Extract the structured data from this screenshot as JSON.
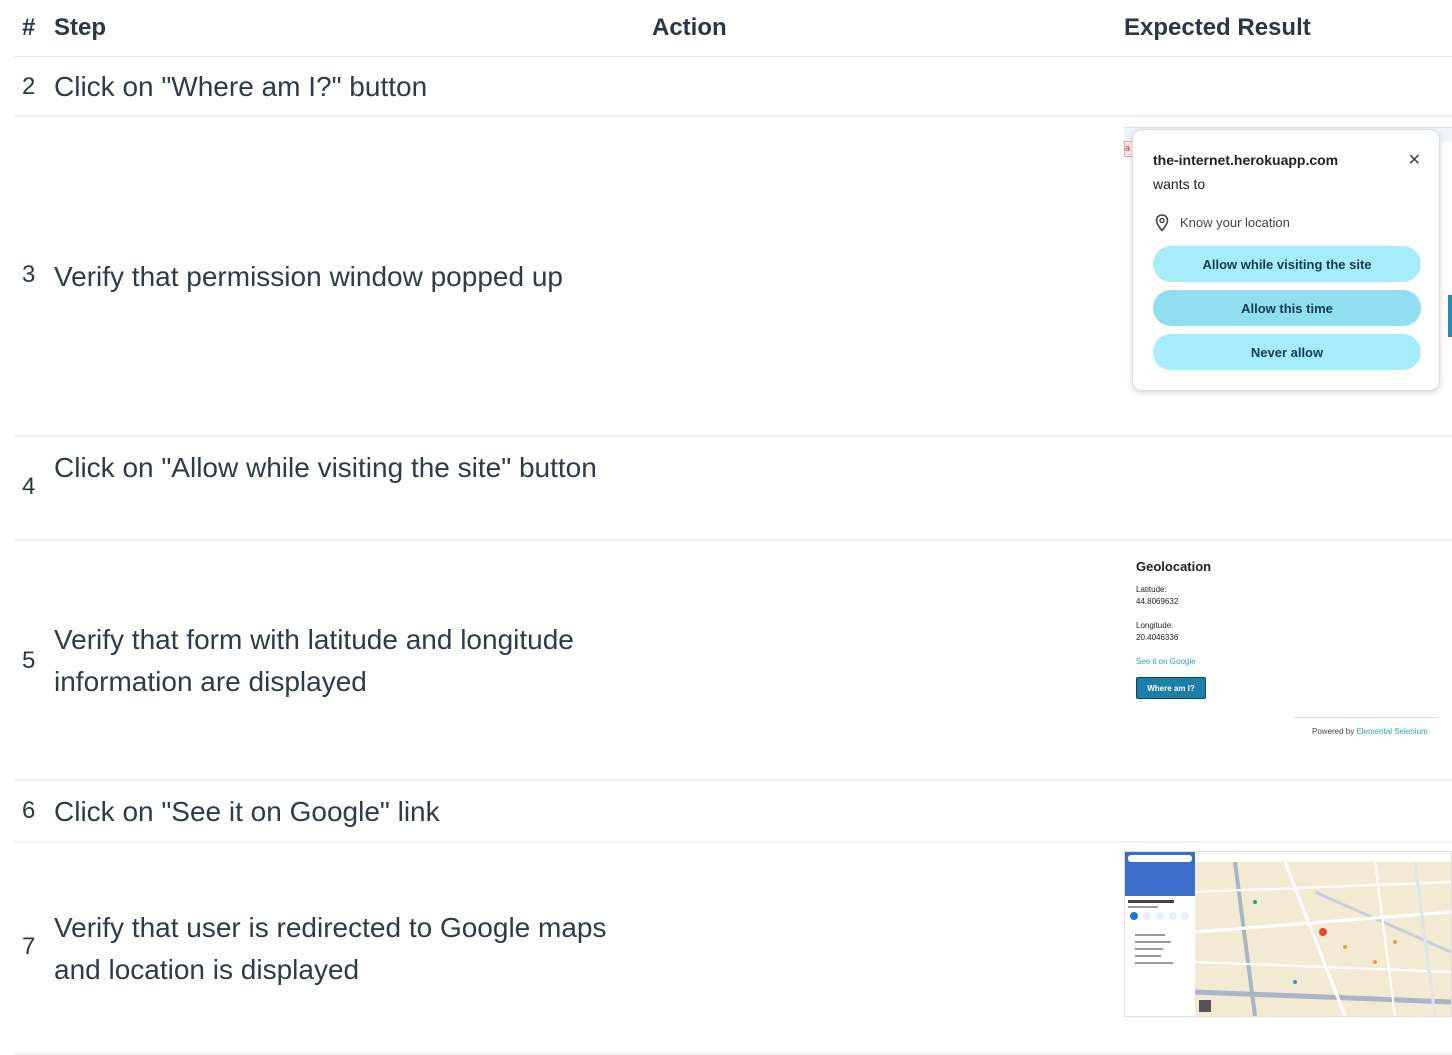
{
  "header": {
    "num": "#",
    "step": "Step",
    "action": "Action",
    "expected": "Expected Result"
  },
  "rows": [
    {
      "num": "2",
      "text": "Click on \"Where am I?\" button"
    },
    {
      "num": "3",
      "text": "Verify that permission window popped up"
    },
    {
      "num": "4",
      "text": "Click on \"Allow while visiting the site\" button"
    },
    {
      "num": "5",
      "text": "Verify that form with latitude and longitude information are displayed"
    },
    {
      "num": "6",
      "text": "Click on \"See it on Google\" link"
    },
    {
      "num": "7",
      "text": "Verify that user is redirected to Google maps and location is displayed"
    }
  ],
  "permission": {
    "site": "the-internet.herokuapp.com",
    "wants": "wants to",
    "close": "✕",
    "know": "Know your location",
    "allow_site": "Allow while visiting the site",
    "allow_once": "Allow this time",
    "never": "Never allow",
    "red_badge": "a"
  },
  "geolocation": {
    "title": "Geolocation",
    "lat_label": "Latitude:",
    "lat_value": "44.8069632",
    "lon_label": "Longitude:",
    "lon_value": "20.4046336",
    "link": "See it on Google",
    "button": "Where am I?",
    "powered_prefix": "Powered by ",
    "powered_link": "Elemental Selenium"
  },
  "colors": {
    "accent": "#1b7fa6",
    "pill": "#a6ecfa",
    "link": "#2a9fd6"
  }
}
